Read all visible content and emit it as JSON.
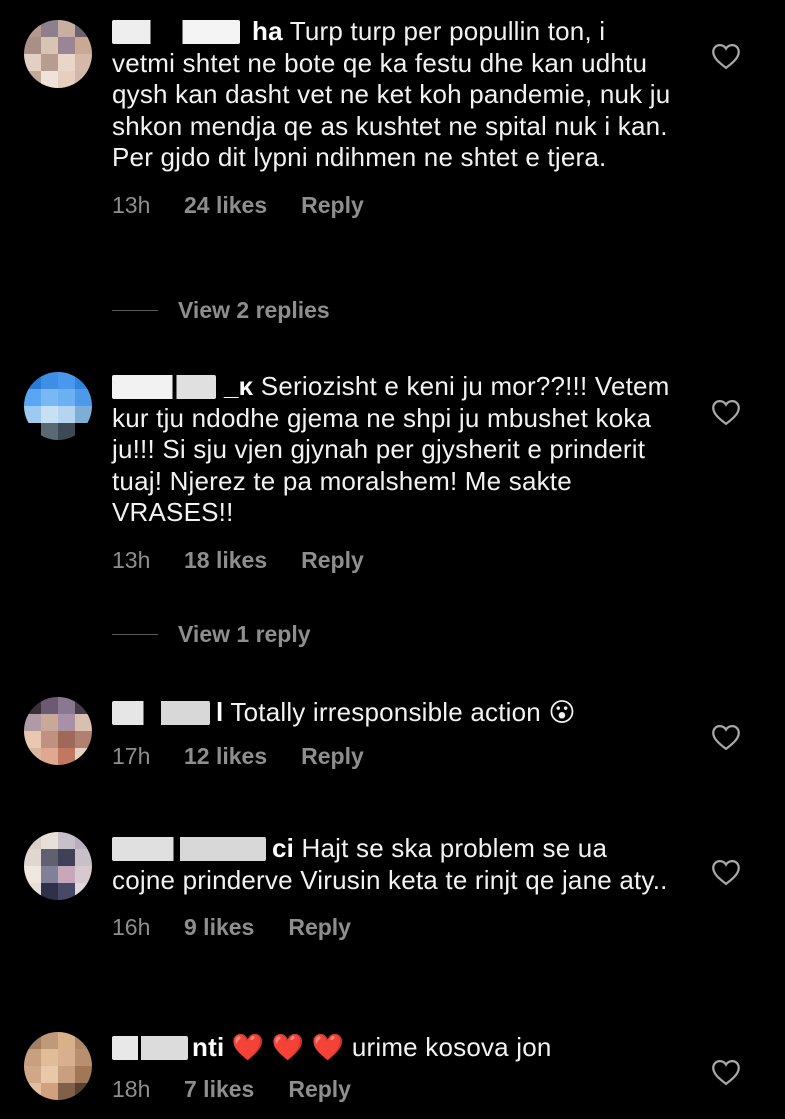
{
  "comments": [
    {
      "username": "ha",
      "text": "Turp turp per popullin ton, i vetmi shtet ne bote qe ka festu dhe kan udhtu qysh kan dasht vet ne ket koh pandemie, nuk ju shkon mendja qe as kushtet ne spital nuk i kan. Per gjdo dit lypni ndihmen ne shtet e tjera.",
      "time": "13h",
      "likes": "24 likes",
      "reply": "Reply",
      "view_replies": "View 2 replies"
    },
    {
      "username": "_κ",
      "text": "Seriozisht e keni ju mor??!!! Vetem kur tju ndodhe gjema ne shpi ju mbushet koka ju!!! Si sju vjen gjynah per gjysherit e prinderit tuaj! Njerez te pa moralshem! Me sakte VRASES!!",
      "time": "13h",
      "likes": "18 likes",
      "reply": "Reply",
      "view_replies": "View 1 reply"
    },
    {
      "username": "l",
      "text": "Totally irresponsible action",
      "emoji": "😮",
      "time": "17h",
      "likes": "12 likes",
      "reply": "Reply"
    },
    {
      "username": "ci",
      "text": "Hajt se ska problem se ua cojne prinderve Virusin keta te rinjt qe jane aty..",
      "time": "16h",
      "likes": "9 likes",
      "reply": "Reply"
    },
    {
      "username": "nti",
      "hearts": "❤️ ❤️ ❤️",
      "text": "urime kosova jon",
      "time": "18h",
      "likes": "7 likes",
      "reply": "Reply"
    }
  ],
  "icons": {
    "like": "heart-outline-icon"
  }
}
